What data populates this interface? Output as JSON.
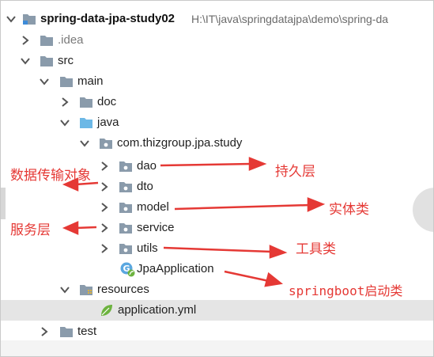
{
  "project": {
    "name": "spring-data-jpa-study02",
    "path": "H:\\IT\\java\\springdatajpa\\demo\\spring-da"
  },
  "tree": {
    "idea": ".idea",
    "src": "src",
    "main": "main",
    "doc": "doc",
    "java": "java",
    "package": "com.thizgroup.jpa.study",
    "dao": "dao",
    "dto": "dto",
    "model": "model",
    "service": "service",
    "utils": "utils",
    "jpa_application": "JpaApplication",
    "resources": "resources",
    "application_yml": "application.yml",
    "test": "test"
  },
  "annotations": {
    "persistence_layer": "持久层",
    "data_transfer_object": "数据传输对象",
    "entity_class": "实体类",
    "service_layer": "服务层",
    "utility_class": "工具类",
    "springboot_startup_class": "springboot启动类"
  },
  "colors": {
    "annotation_red": "#e53935",
    "folder_gray": "#8a9bab",
    "source_folder_blue": "#6cb8e6",
    "selection": "#e5e5e5"
  }
}
